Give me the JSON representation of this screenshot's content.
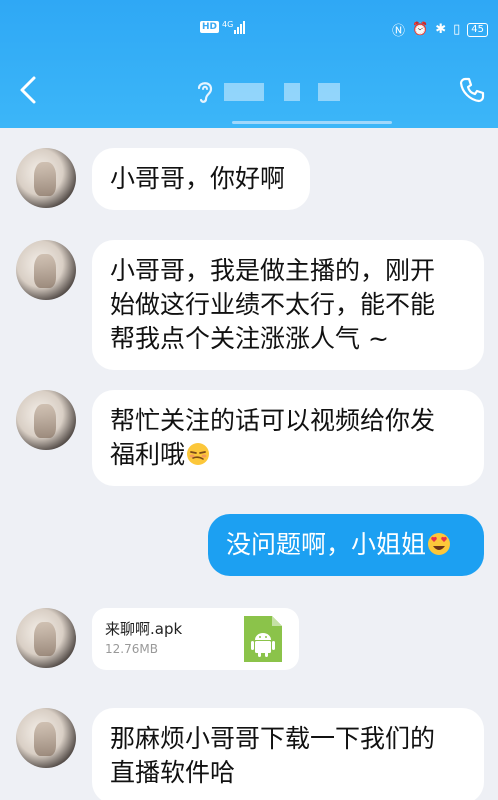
{
  "status_bar": {
    "hd": "HD",
    "network": "4G",
    "battery": "45"
  },
  "colors": {
    "header": "#2fa8f5",
    "my_bubble": "#1ca0f2",
    "background": "#eef0f5"
  },
  "icons": {
    "back": "chevron-left-icon",
    "ear": "ear-icon",
    "call": "phone-icon"
  },
  "messages": [
    {
      "from": "other",
      "text": "小哥哥，你好啊"
    },
    {
      "from": "other",
      "line1": "小哥哥，我是做主播的，刚开",
      "line2": "始做这行业绩不太行，能不能",
      "line3": "帮我点个关注涨涨人气 ~"
    },
    {
      "from": "other",
      "line1": "帮忙关注的话可以视频给你发",
      "line2": "福利哦",
      "emoji": "smug-face-emoji"
    },
    {
      "from": "me",
      "text": "没问题啊，小姐姐",
      "emoji": "heart-eyes-emoji"
    },
    {
      "from": "other",
      "type": "file",
      "file_name": "来聊啊.apk",
      "file_size": "12.76MB",
      "file_icon": "android-apk-icon"
    },
    {
      "from": "other",
      "line1": "那麻烦小哥哥下载一下我们的",
      "line2": "直播软件哈"
    }
  ]
}
